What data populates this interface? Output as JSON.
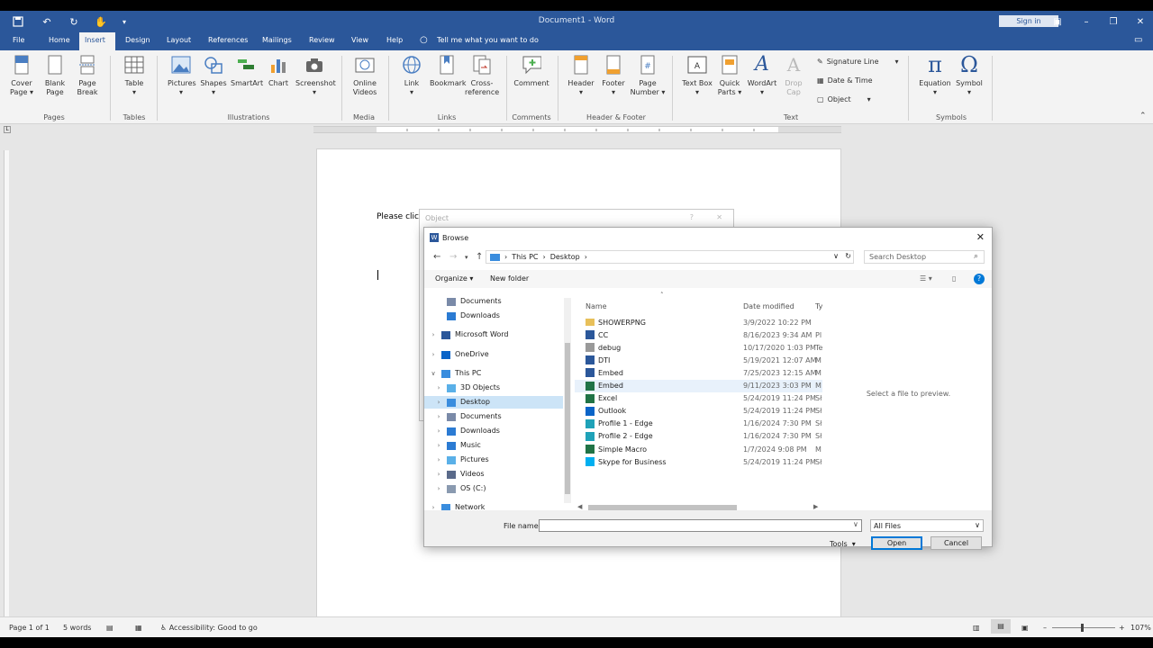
{
  "titlebar": {
    "title": "Document1 - Word",
    "sign_in": "Sign in"
  },
  "tabs": [
    "File",
    "Home",
    "Insert",
    "Design",
    "Layout",
    "References",
    "Mailings",
    "Review",
    "View",
    "Help"
  ],
  "tell_me": "Tell me what you want to do",
  "ribbon": {
    "cover_page": "Cover Page",
    "blank_page": "Blank Page",
    "page_break": "Page Break",
    "table": "Table",
    "pictures": "Pictures",
    "shapes": "Shapes",
    "smartart": "SmartArt",
    "chart": "Chart",
    "screenshot": "Screenshot",
    "online_videos": "Online Videos",
    "link": "Link",
    "bookmark": "Bookmark",
    "cross_reference": "Cross-reference",
    "comment": "Comment",
    "header": "Header",
    "footer": "Footer",
    "page_number": "Page Number",
    "text_box": "Text Box",
    "quick_parts": "Quick Parts",
    "wordart": "WordArt",
    "drop_cap": "Drop Cap",
    "signature_line": "Signature Line",
    "date_time": "Date & Time",
    "object": "Object",
    "equation": "Equation",
    "symbol": "Symbol",
    "groups": {
      "pages": "Pages",
      "tables": "Tables",
      "illustrations": "Illustrations",
      "media": "Media",
      "links": "Links",
      "comments": "Comments",
      "header_footer": "Header & Footer",
      "text": "Text",
      "symbols": "Symbols"
    }
  },
  "document": {
    "text": "Please click"
  },
  "object_dialog": {
    "title": "Object"
  },
  "browse": {
    "title": "Browse",
    "breadcrumb": [
      "This PC",
      "Desktop"
    ],
    "search_placeholder": "Search Desktop",
    "organize": "Organize",
    "new_folder": "New folder",
    "tree": [
      {
        "label": "Documents",
        "icon": "documents-icon",
        "level": 2,
        "expander": false
      },
      {
        "label": "Downloads",
        "icon": "downloads-icon",
        "level": 2,
        "expander": false
      },
      {
        "label": "Microsoft Word",
        "icon": "word-icon",
        "level": 1,
        "expander": true
      },
      {
        "label": "OneDrive",
        "icon": "onedrive-icon",
        "level": 1,
        "expander": true
      },
      {
        "label": "This PC",
        "icon": "pc-icon",
        "level": 1,
        "expander": true,
        "expanded": true
      },
      {
        "label": "3D Objects",
        "icon": "3d-objects-icon",
        "level": 2,
        "expander": true
      },
      {
        "label": "Desktop",
        "icon": "desktop-icon",
        "level": 2,
        "expander": true,
        "selected": true
      },
      {
        "label": "Documents",
        "icon": "documents-icon",
        "level": 2,
        "expander": true
      },
      {
        "label": "Downloads",
        "icon": "downloads-icon",
        "level": 2,
        "expander": true
      },
      {
        "label": "Music",
        "icon": "music-icon",
        "level": 2,
        "expander": true
      },
      {
        "label": "Pictures",
        "icon": "pictures-icon",
        "level": 2,
        "expander": true
      },
      {
        "label": "Videos",
        "icon": "videos-icon",
        "level": 2,
        "expander": true
      },
      {
        "label": "OS (C:)",
        "icon": "drive-icon",
        "level": 2,
        "expander": true
      },
      {
        "label": "Network",
        "icon": "network-icon",
        "level": 1,
        "expander": true
      }
    ],
    "columns": {
      "name": "Name",
      "date": "Date modified",
      "type": "Ty"
    },
    "files": [
      {
        "name": "SHOWERPNG",
        "date": "3/9/2022 10:22 PM",
        "type": "",
        "icon": "folder-icon"
      },
      {
        "name": "CC",
        "date": "8/16/2023 9:34 AM",
        "type": "Pl",
        "icon": "word-doc-icon"
      },
      {
        "name": "debug",
        "date": "10/17/2020 1:03 PM",
        "type": "Te",
        "icon": "text-file-icon"
      },
      {
        "name": "DTI",
        "date": "5/19/2021 12:07 AM",
        "type": "M",
        "icon": "word-doc-icon"
      },
      {
        "name": "Embed",
        "date": "7/25/2023 12:15 AM",
        "type": "M",
        "icon": "word-doc-icon"
      },
      {
        "name": "Embed",
        "date": "9/11/2023 3:03 PM",
        "type": "M",
        "icon": "excel-doc-icon",
        "hover": true
      },
      {
        "name": "Excel",
        "date": "5/24/2019 11:24 PM",
        "type": "Sł",
        "icon": "excel-icon"
      },
      {
        "name": "Outlook",
        "date": "5/24/2019 11:24 PM",
        "type": "Sł",
        "icon": "outlook-icon"
      },
      {
        "name": "Profile 1 - Edge",
        "date": "1/16/2024 7:30 PM",
        "type": "Sł",
        "icon": "edge-icon"
      },
      {
        "name": "Profile 2 - Edge",
        "date": "1/16/2024 7:30 PM",
        "type": "Sł",
        "icon": "edge-icon"
      },
      {
        "name": "Simple Macro",
        "date": "1/7/2024 9:08 PM",
        "type": "M",
        "icon": "excel-doc-icon"
      },
      {
        "name": "Skype for Business",
        "date": "5/24/2019 11:24 PM",
        "type": "Sł",
        "icon": "skype-icon"
      }
    ],
    "preview": "Select a file to preview.",
    "file_name_label": "File name:",
    "file_name_value": "",
    "filter": "All Files",
    "tools": "Tools",
    "open": "Open",
    "cancel": "Cancel"
  },
  "status": {
    "page": "Page 1 of 1",
    "words": "5 words",
    "accessibility": "Accessibility: Good to go",
    "zoom": "107%"
  },
  "colors": {
    "word_blue": "#2b579a",
    "selection": "#cce4f7",
    "accent": "#0078d7"
  }
}
